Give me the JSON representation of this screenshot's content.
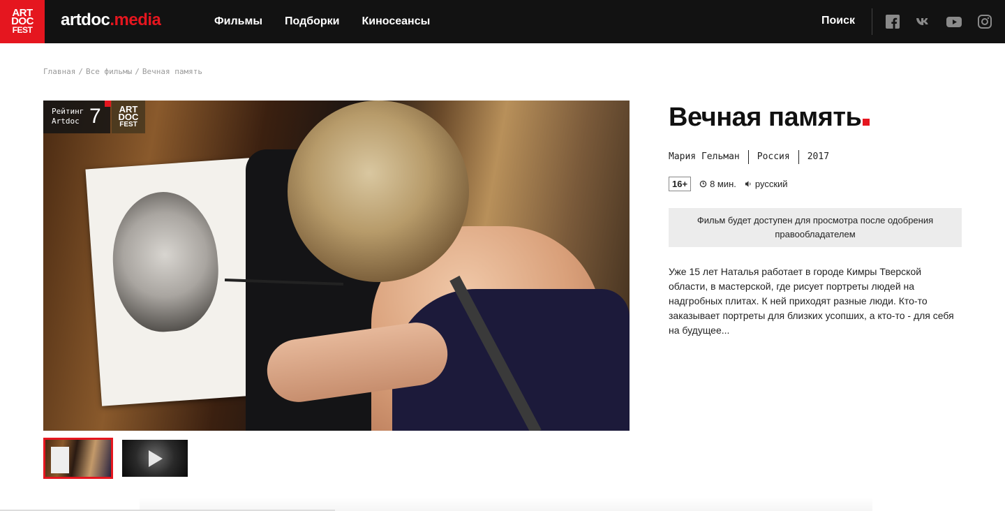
{
  "header": {
    "logo_lines": [
      "ART",
      "DOC",
      "FEST"
    ],
    "brand_main": "artdoc",
    "brand_accent": ".media",
    "nav": [
      "Фильмы",
      "Подборки",
      "Киносеансы"
    ],
    "search_label": "Поиск",
    "social_icons": [
      "facebook-icon",
      "vk-icon",
      "youtube-icon",
      "instagram-icon"
    ]
  },
  "breadcrumb": [
    "Главная",
    "Все фильмы",
    "Вечная память"
  ],
  "rating": {
    "label_line1": "Рейтинг",
    "label_line2": "Artdoc",
    "value": "7"
  },
  "fest_badge": [
    "ART",
    "DOC",
    "FEST"
  ],
  "film": {
    "title": "Вечная память",
    "director": "Мария Гельман",
    "country": "Россия",
    "year": "2017",
    "age": "16+",
    "duration": "8 мин.",
    "language": "русский",
    "notice": "Фильм будет доступен для просмотра после одобрения правообладателем",
    "description": "Уже 15 лет Наталья работает в городе Кимры Тверской области, в мастерской, где рисует портреты людей на надгробных плитах. К ней приходят разные люди. Кто-то заказывает портреты для близких усопших, а кто-то - для себя на будущее..."
  },
  "colors": {
    "accent": "#e5161f",
    "header_bg": "#121212",
    "notice_bg": "#ececec"
  }
}
